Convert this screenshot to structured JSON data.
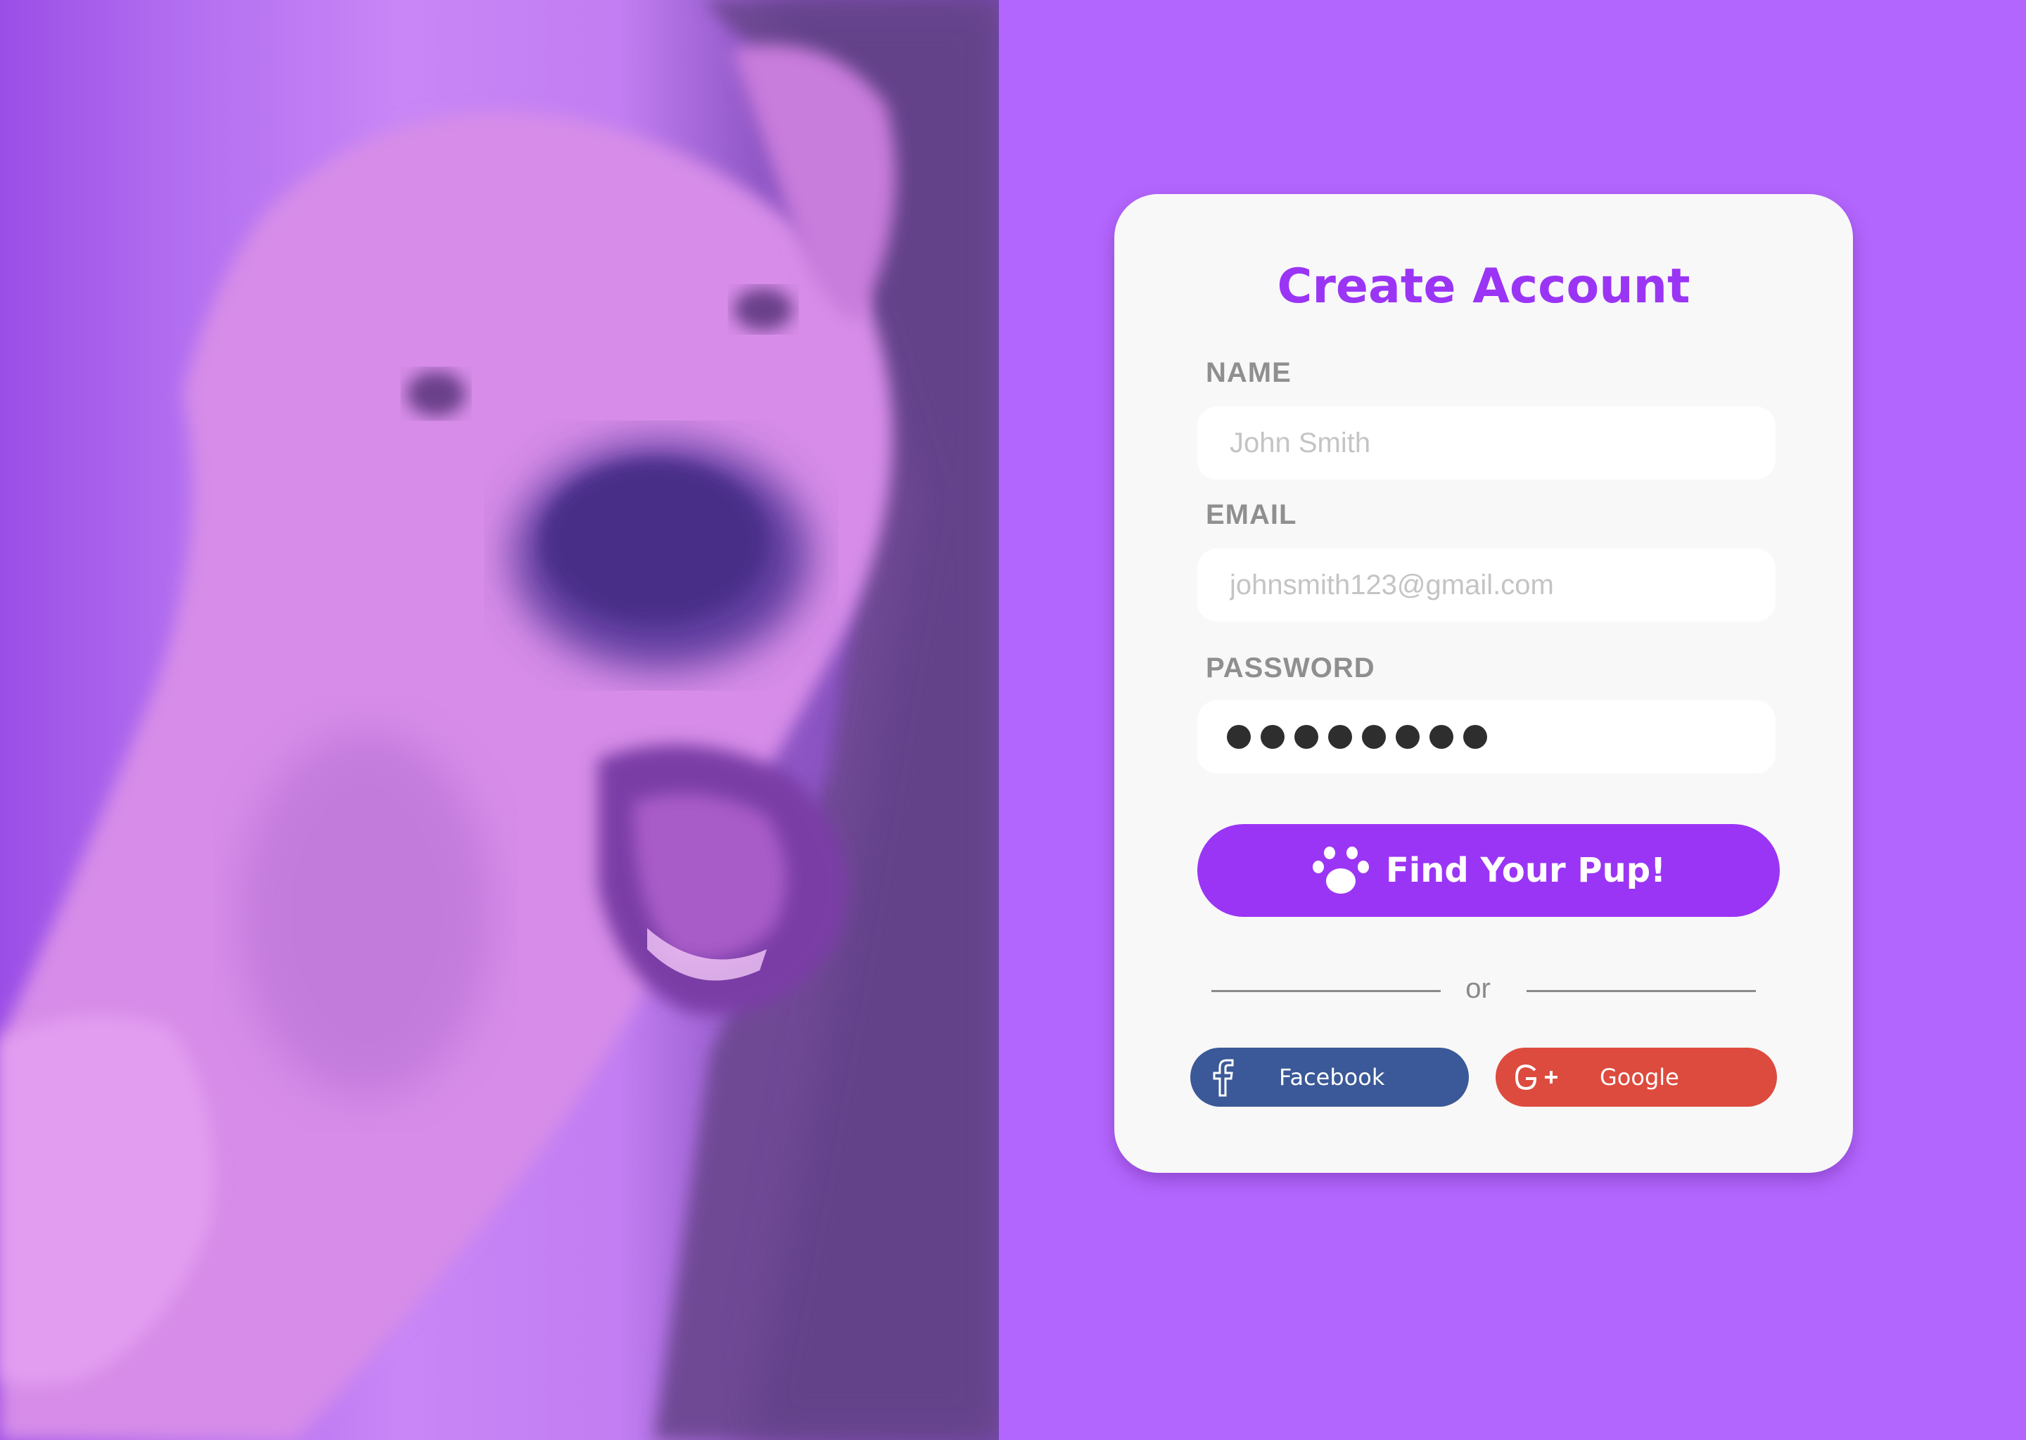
{
  "form": {
    "title": "Create Account",
    "name_label": "NAME",
    "name_placeholder": "John Smith",
    "email_label": "EMAIL",
    "email_placeholder": "johnsmith123@gmail.com",
    "password_label": "PASSWORD",
    "password_mask_count": 8,
    "submit_label": "Find Your Pup!",
    "submit_icon": "paw-icon",
    "divider_text": "or"
  },
  "social": {
    "facebook_label": "Facebook",
    "facebook_icon": "facebook-icon",
    "google_label": "Google",
    "google_icon": "google-plus-icon"
  },
  "colors": {
    "background": "#b366fd",
    "accent": "#9b35f5",
    "facebook": "#3b5998",
    "google": "#dd4b3e",
    "card": "#f8f8f8"
  }
}
